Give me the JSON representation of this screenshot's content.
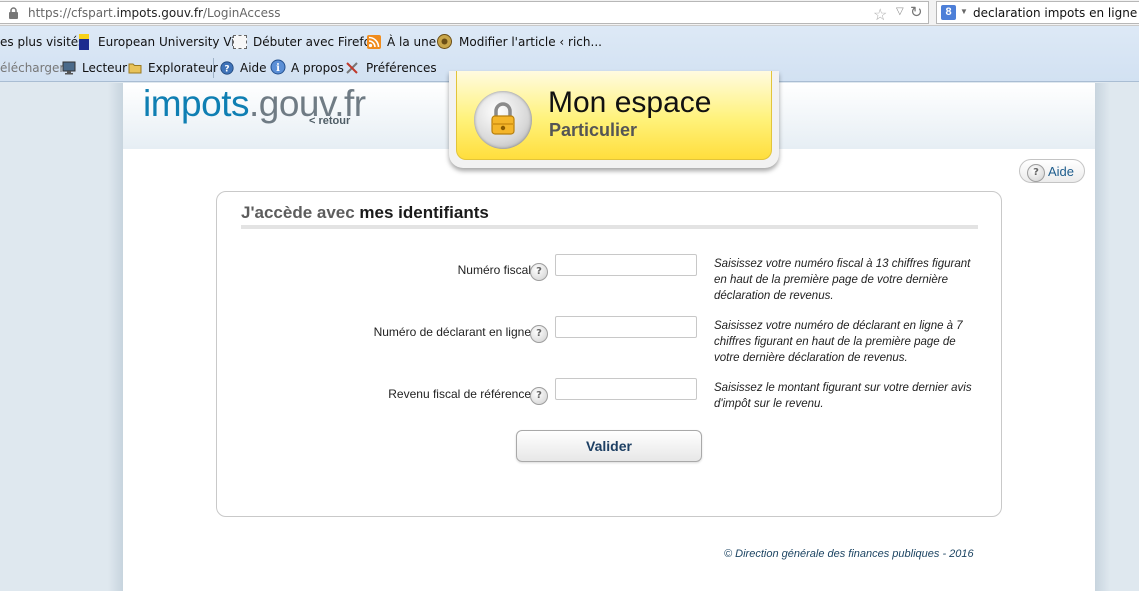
{
  "browser": {
    "url_prefix": "https://cfspart.",
    "url_domain": "impots.gouv.fr",
    "url_path": "/LoginAccess",
    "search_engine_letter": "8",
    "search_query": "declaration impots en ligne"
  },
  "bookmarks": {
    "row1": [
      {
        "label": "es plus visités",
        "icon": "none"
      },
      {
        "label": "European University Vi...",
        "icon": "eu-flag-icon"
      },
      {
        "label": "Débuter avec Firefox",
        "icon": "dotted-page-icon"
      },
      {
        "label": "À la une",
        "icon": "rss-icon"
      },
      {
        "label": "Modifier l'article ‹ rich...",
        "icon": "wordpress-icon"
      }
    ],
    "row2": [
      {
        "label": "élécharger",
        "icon": "none"
      },
      {
        "label": "Lecteur",
        "icon": "monitor-icon"
      },
      {
        "label": "Explorateur",
        "icon": "folder-icon"
      },
      {
        "label": "Aide",
        "icon": "help-globe-icon"
      },
      {
        "label": "A propos",
        "icon": "info-icon"
      },
      {
        "label": "Préférences",
        "icon": "tools-icon"
      }
    ]
  },
  "header": {
    "logo_part1": "impots",
    "logo_part2": ".gouv.fr",
    "back_link": "< retour",
    "espace_title": "Mon espace",
    "espace_subtitle": "Particulier",
    "help_label": "Aide"
  },
  "login": {
    "title_part1": "J'accède avec",
    "title_part2": " mes identifiants",
    "fields": [
      {
        "label": "Numéro fiscal",
        "value": "",
        "hint": "Saisissez votre numéro fiscal à 13 chiffres figurant en haut de la première page de votre dernière déclaration de revenus."
      },
      {
        "label": "Numéro de déclarant en ligne",
        "value": "",
        "hint": "Saisissez votre numéro de déclarant en ligne à 7 chiffres figurant en haut de la première page de votre dernière déclaration de revenus."
      },
      {
        "label": "Revenu fiscal de référence",
        "value": "",
        "hint": "Saisissez le montant figurant sur votre dernier avis d'impôt sur le revenu."
      }
    ],
    "submit_label": "Valider"
  },
  "footer": {
    "text": "© Direction générale des finances publiques - 2016"
  },
  "colors": {
    "logo_blue": "#0f7fb3",
    "badge_yellow": "#ffe84a",
    "link_blue": "#1e5d8d"
  }
}
